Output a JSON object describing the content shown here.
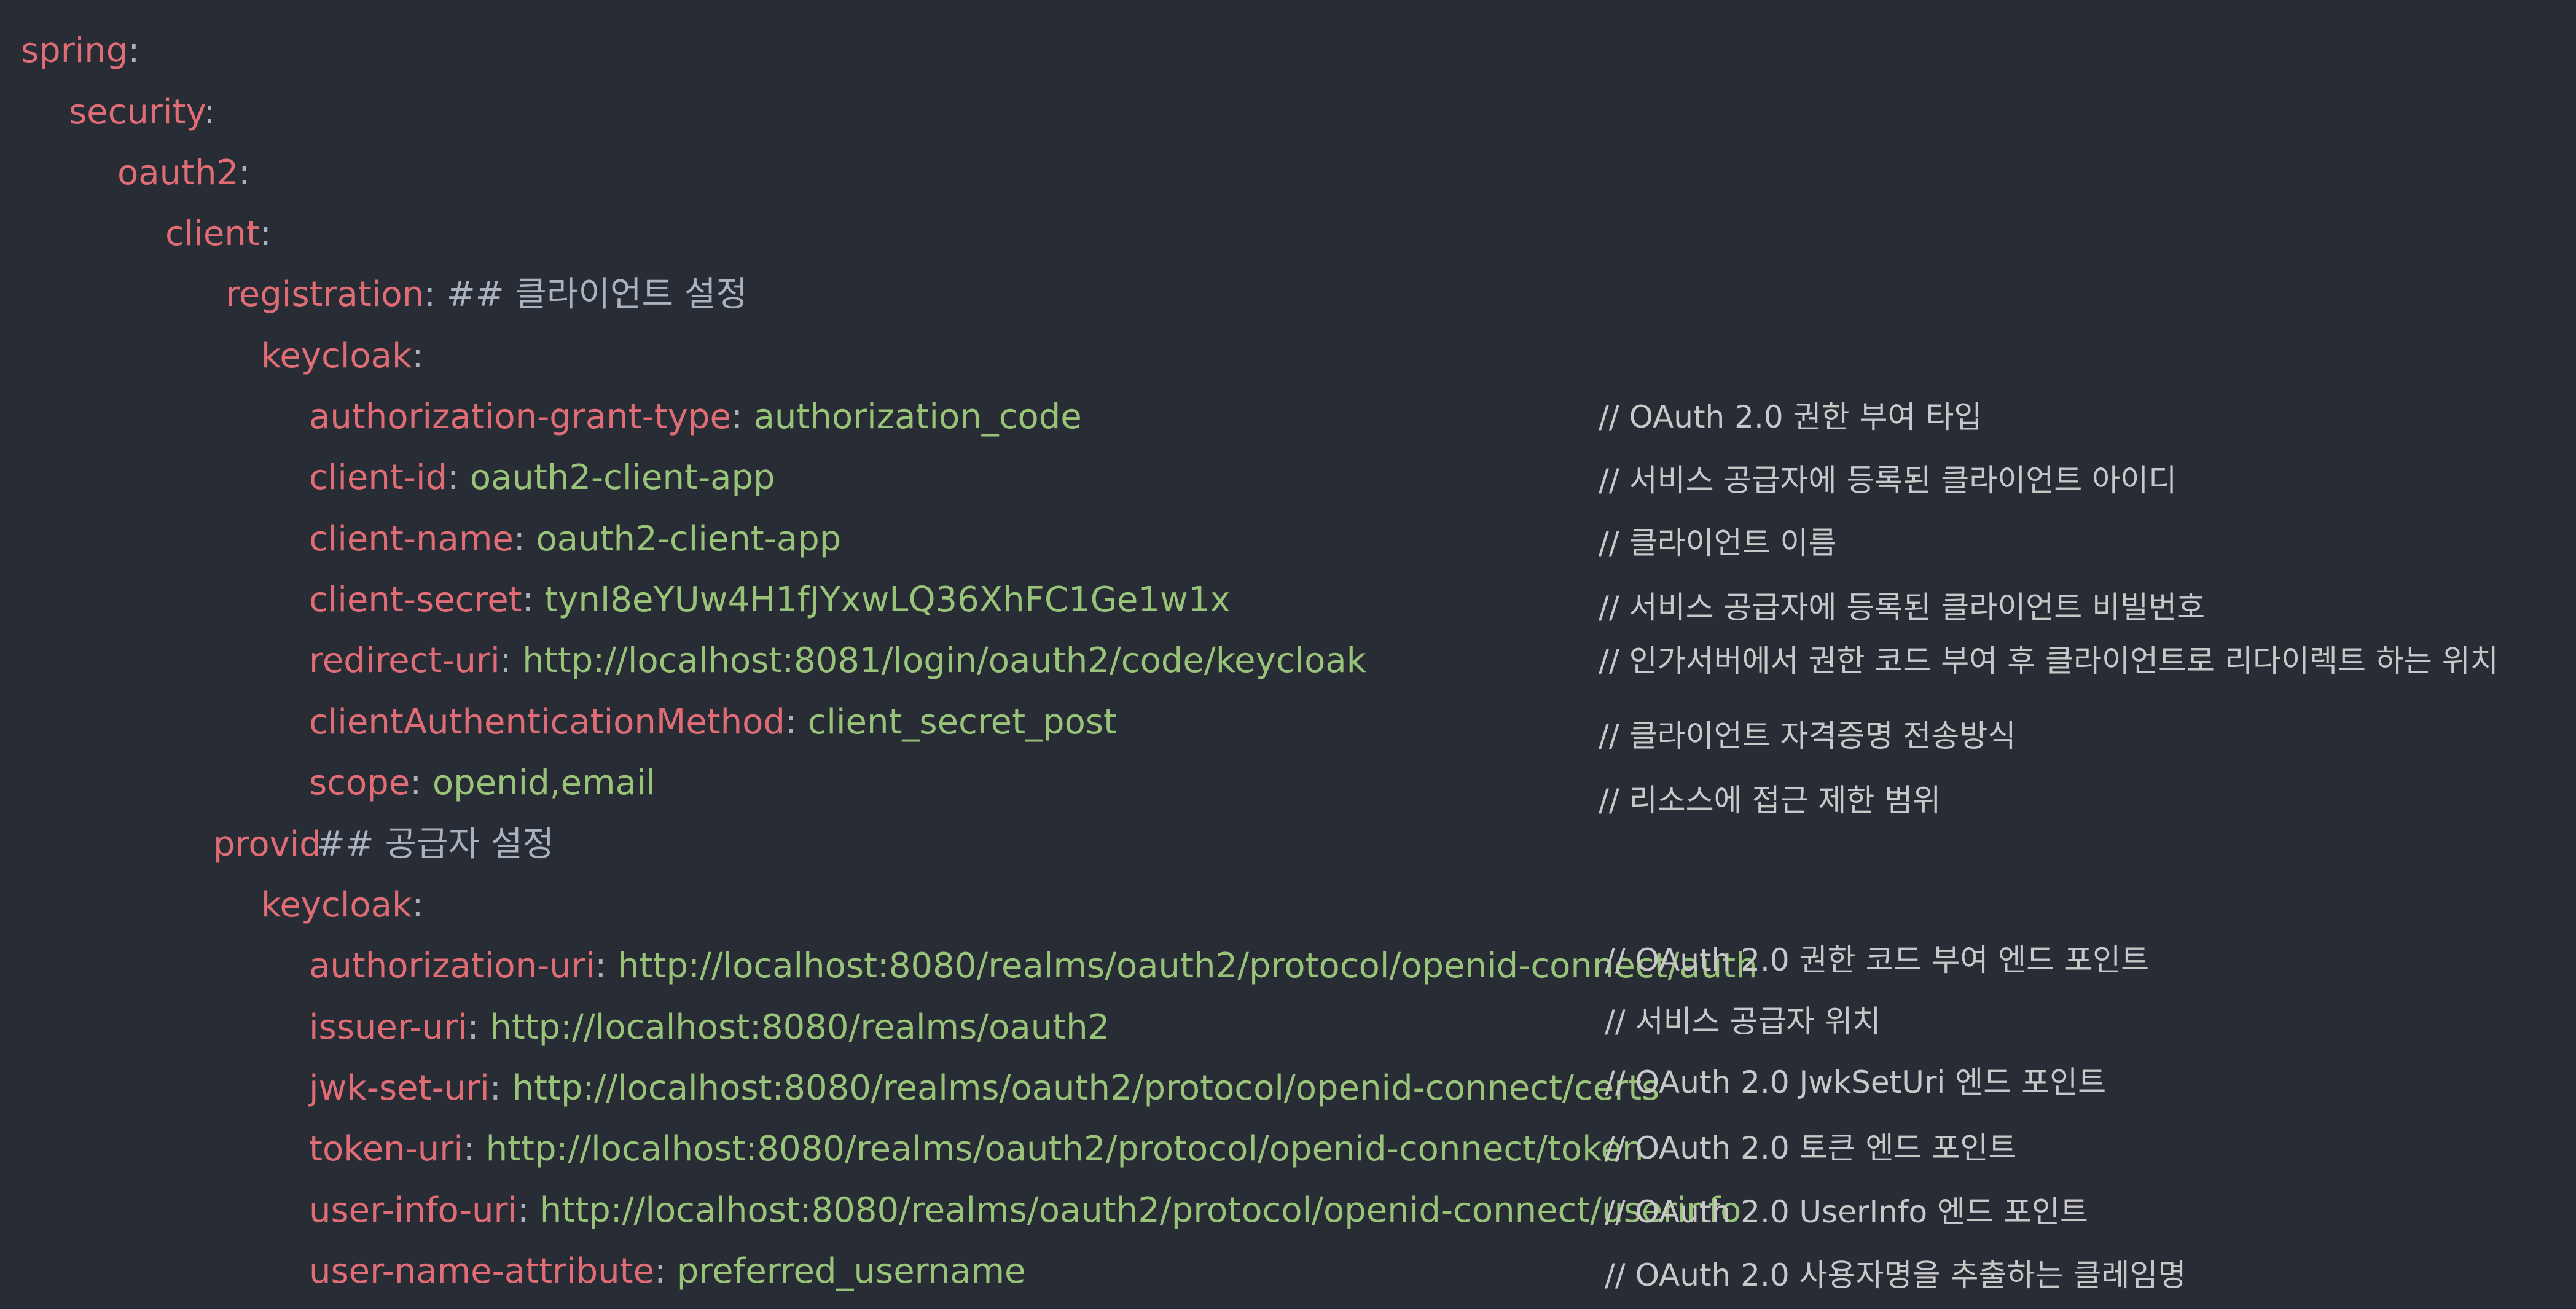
{
  "lines": [
    {
      "key": "spring",
      "colon": ":",
      "value": "",
      "hash": "",
      "comment": ""
    },
    {
      "key": "security",
      "colon": ":",
      "value": "",
      "hash": "",
      "comment": ""
    },
    {
      "key": "oauth2",
      "colon": ":",
      "value": "",
      "hash": "",
      "comment": ""
    },
    {
      "key": "client",
      "colon": ":",
      "value": "",
      "hash": "",
      "comment": ""
    },
    {
      "key": "registration",
      "colon": ":",
      "value": "",
      "hash": " ## 클라이언트 설정",
      "comment": ""
    },
    {
      "key": "keycloak",
      "colon": ":",
      "value": "",
      "hash": "",
      "comment": ""
    },
    {
      "key": "authorization-grant-type",
      "colon": ": ",
      "value": "authorization_code",
      "hash": "",
      "comment": "// OAuth 2.0 권한 부여 타입"
    },
    {
      "key": "client-id",
      "colon": ": ",
      "value": "oauth2-client-app",
      "hash": "",
      "comment": "// 서비스 공급자에 등록된 클라이언트 아이디"
    },
    {
      "key": "client-name",
      "colon": ": ",
      "value": "oauth2-client-app",
      "hash": "",
      "comment": "// 클라이언트 이름"
    },
    {
      "key": "client-secret",
      "colon": ": ",
      "value": "tynI8eYUw4H1fJYxwLQ36XhFC1Ge1w1x",
      "hash": "",
      "comment": "// 서비스 공급자에 등록된 클라이언트 비빌번호"
    },
    {
      "key": "redirect-uri",
      "colon": ": ",
      "value": "http://localhost:8081/login/oauth2/code/keycloak",
      "hash": "",
      "comment": "// 인가서버에서 권한 코드 부여 후 클라이언트로 리다이렉트 하는 위치"
    },
    {
      "key": "clientAuthenticationMethod",
      "colon": ": ",
      "value": "client_secret_post",
      "hash": "",
      "comment": "// 클라이언트 자격증명 전송방식"
    },
    {
      "key": "scope",
      "colon": ": ",
      "value": "openid,email",
      "hash": "",
      "comment": "// 리소스에 접근 제한 범위"
    },
    {
      "key": "provid",
      "colon": "",
      "value": "",
      "hash": "## 공급자 설정",
      "comment": ""
    },
    {
      "key": "keycloak",
      "colon": ":",
      "value": "",
      "hash": "",
      "comment": ""
    },
    {
      "key": "authorization-uri",
      "colon": ": ",
      "value": "http://localhost:8080/realms/oauth2/protocol/openid-connect/auth",
      "hash": "",
      "comment": "//  OAuth 2.0 권한 코드 부여 엔드 포인트"
    },
    {
      "key": "issuer-uri",
      "colon": ": ",
      "value": "http://localhost:8080/realms/oauth2",
      "hash": "",
      "comment": "// 서비스 공급자 위치"
    },
    {
      "key": "jwk-set-uri",
      "colon": ": ",
      "value": "http://localhost:8080/realms/oauth2/protocol/openid-connect/certs",
      "hash": "",
      "comment": "// OAuth 2.0 JwkSetUri 엔드 포인트"
    },
    {
      "key": "token-uri",
      "colon": ": ",
      "value": "http://localhost:8080/realms/oauth2/protocol/openid-connect/token",
      "hash": "",
      "comment": "// OAuth 2.0 토큰 엔드 포인트"
    },
    {
      "key": "user-info-uri",
      "colon": ": ",
      "value": "http://localhost:8080/realms/oauth2/protocol/openid-connect/userinfo",
      "hash": "",
      "comment": "// OAuth 2.0 UserInfo 엔드 포인트"
    },
    {
      "key": "user-name-attribute",
      "colon": ": ",
      "value": "preferred_username",
      "hash": "",
      "comment": "// OAuth 2.0 사용자명을 추출하는 클레임명"
    }
  ],
  "colors": {
    "background": "#282c34",
    "key": "#e06c75",
    "value": "#98c379",
    "comment": "#c8c8c8"
  }
}
